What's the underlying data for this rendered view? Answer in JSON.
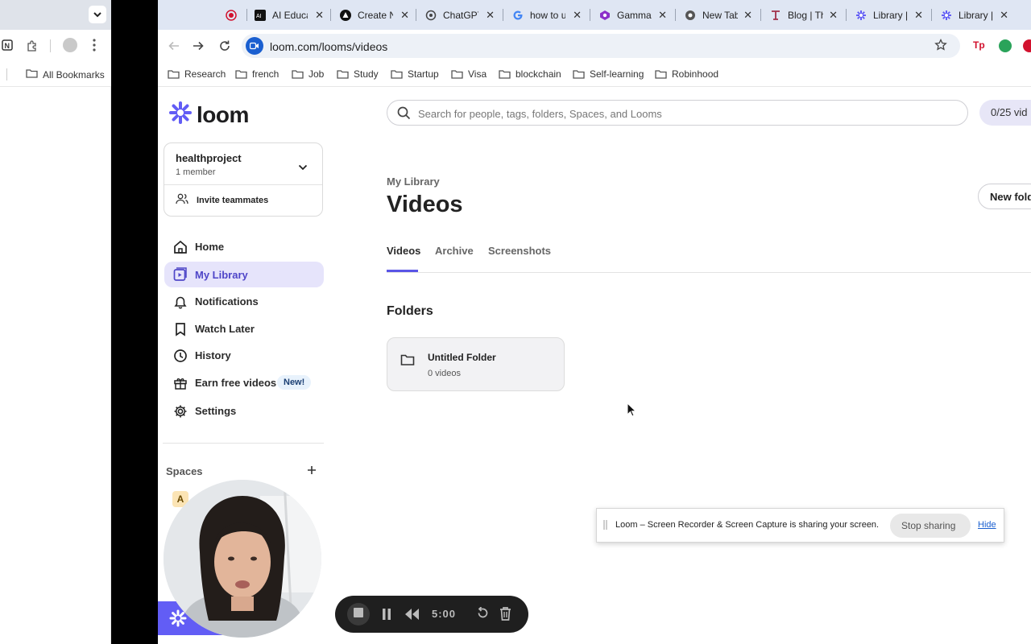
{
  "left_window": {
    "bookmarks_label": "All Bookmarks"
  },
  "browser": {
    "tabs": [
      {
        "label": "",
        "icon": "record-icon"
      },
      {
        "label": "AI Educa",
        "icon": "ai-favicon"
      },
      {
        "label": "Create N",
        "icon": "create-favicon"
      },
      {
        "label": "ChatGPT",
        "icon": "chatgpt-favicon"
      },
      {
        "label": "how to u",
        "icon": "google-favicon"
      },
      {
        "label": "Gamma",
        "icon": "gamma-favicon"
      },
      {
        "label": "New Tab",
        "icon": "chrome-favicon"
      },
      {
        "label": "Blog | Th",
        "icon": "blog-favicon"
      },
      {
        "label": "Library |",
        "icon": "loom-favicon"
      },
      {
        "label": "Library |",
        "icon": "loom-favicon"
      }
    ],
    "url": "loom.com/looms/videos",
    "bookmarks": [
      "Research",
      "french",
      "Job",
      "Study",
      "Startup",
      "Visa",
      "blockchain",
      "Self-learning",
      "Robinhood"
    ]
  },
  "sidebar": {
    "logo_text": "loom",
    "workspace": {
      "name": "healthproject",
      "members": "1 member"
    },
    "invite_label": "Invite teammates",
    "nav": [
      {
        "label": "Home",
        "icon": "home-icon"
      },
      {
        "label": "My Library",
        "icon": "library-icon"
      },
      {
        "label": "Notifications",
        "icon": "bell-icon"
      },
      {
        "label": "Watch Later",
        "icon": "bookmark-icon"
      },
      {
        "label": "History",
        "icon": "clock-icon"
      },
      {
        "label": "Earn free videos",
        "icon": "gift-icon"
      },
      {
        "label": "Settings",
        "icon": "gear-icon"
      }
    ],
    "earn_badge": "New!",
    "spaces_label": "Spaces",
    "space_avatar": "A"
  },
  "main": {
    "search_placeholder": "Search for people, tags, folders, Spaces, and Looms",
    "video_count": "0/25 vid",
    "breadcrumb": "My Library",
    "page_title": "Videos",
    "new_folder_label": "New fold",
    "tabs": [
      "Videos",
      "Archive",
      "Screenshots"
    ],
    "folders_heading": "Folders",
    "folder": {
      "name": "Untitled Folder",
      "count": "0 videos"
    }
  },
  "sharing_bar": {
    "message": "Loom – Screen Recorder & Screen Capture is sharing your screen.",
    "stop_label": "Stop sharing",
    "hide_label": "Hide"
  },
  "recorder": {
    "timer": "5:00"
  },
  "colors": {
    "loom_purple": "#625df5",
    "active_nav_bg": "#e6e4fb",
    "tab_underline": "#5a55e6",
    "link_blue": "#1a5fd0"
  }
}
